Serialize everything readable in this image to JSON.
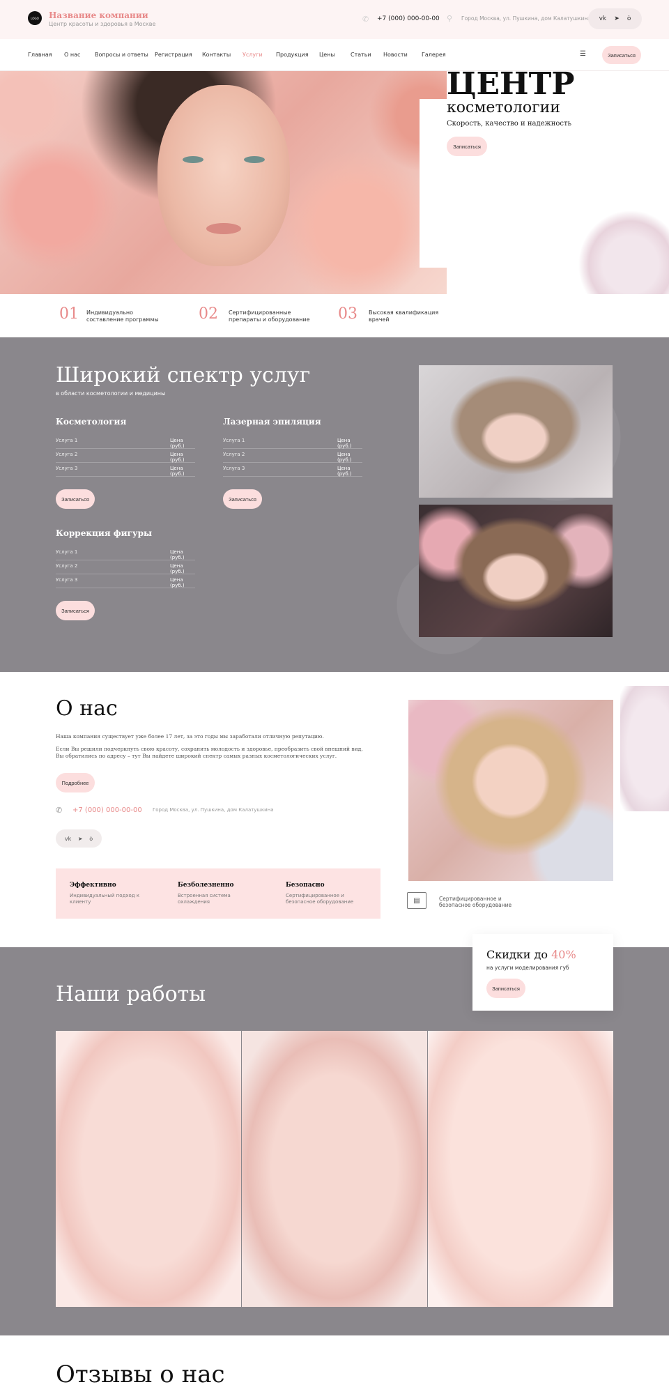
{
  "header": {
    "logo_text": "LOGO",
    "company_name": "Название компании",
    "company_sub": "Центр красоты и здоровья в Москве",
    "phone": "+7 (000) 000-00-00",
    "address": "Город Москва, ул. Пушкина, дом Калатушкина",
    "social": [
      "vk",
      "tg",
      "ok"
    ]
  },
  "nav": {
    "items": [
      "Главная",
      "О нас",
      "Вопросы и ответы",
      "Регистрация",
      "Контакты",
      "Услуги",
      "Продукция",
      "Цены",
      "Статьи",
      "Новости",
      "Галерея"
    ],
    "active": "Услуги",
    "cta": "Записаться"
  },
  "hero": {
    "title_line1": "ЦЕНТР",
    "title_line2": "косметологии",
    "subtitle": "Скорость, качество и надежность",
    "cta": "Записаться"
  },
  "features": [
    {
      "num": "01",
      "text": "Индивидуально составление программы"
    },
    {
      "num": "02",
      "text": "Сертифицированные препараты и оборудование"
    },
    {
      "num": "03",
      "text": "Высокая квалификация врачей"
    }
  ],
  "services": {
    "title": "Широкий спектр услуг",
    "subtitle": "в области косметологии и медицины",
    "categories": [
      {
        "name": "Косметология",
        "items": [
          {
            "name": "Услуга 1",
            "price": "Цена (руб.)"
          },
          {
            "name": "Услуга 2",
            "price": "Цена (руб.)"
          },
          {
            "name": "Услуга 3",
            "price": "Цена (руб.)"
          }
        ],
        "cta": "Записаться"
      },
      {
        "name": "Лазерная эпиляция",
        "items": [
          {
            "name": "Услуга 1",
            "price": "Цена (руб.)"
          },
          {
            "name": "Услуга 2",
            "price": "Цена (руб.)"
          },
          {
            "name": "Услуга 3",
            "price": "Цена (руб.)"
          }
        ],
        "cta": "Записаться"
      },
      {
        "name": "Коррекция фигуры",
        "items": [
          {
            "name": "Услуга 1",
            "price": "Цена (руб.)"
          },
          {
            "name": "Услуга 2",
            "price": "Цена (руб.)"
          },
          {
            "name": "Услуга 3",
            "price": "Цена (руб.)"
          }
        ],
        "cta": "Записаться"
      }
    ]
  },
  "about": {
    "title": "О нас",
    "p1": "Наша компания существует уже более 17 лет, за это годы мы заработали отличную репутацию.",
    "p2": "Если Вы решили подчеркнуть свою красоту, сохранить молодость и здоровье, преобразить свой внешний вид, Вы обратились по адресу – тут Вы найдете широкий спектр самых разных косметологических услуг.",
    "cta": "Подробнее",
    "phone": "+7 (000) 000-00-00",
    "address": "Город Москва, ул. Пушкина, дом Калатушкина",
    "social": [
      "vk",
      "tg",
      "ok"
    ],
    "benefits": [
      {
        "title": "Эффективно",
        "text": "Индивидуальный подход к клиенту"
      },
      {
        "title": "Безболезненно",
        "text": "Встроенная система охлаждения"
      },
      {
        "title": "Безопасно",
        "text": "Сертифицированное и безопасное оборудование"
      }
    ],
    "cert_text": "Сертифицированное и безопасное оборудование"
  },
  "discount": {
    "prefix": "Скидки до ",
    "percent": "40%",
    "subtitle": "на услуги моделирования губ",
    "cta": "Записаться"
  },
  "works": {
    "title": "Наши работы"
  },
  "reviews": {
    "title": "Отзывы о нас"
  }
}
